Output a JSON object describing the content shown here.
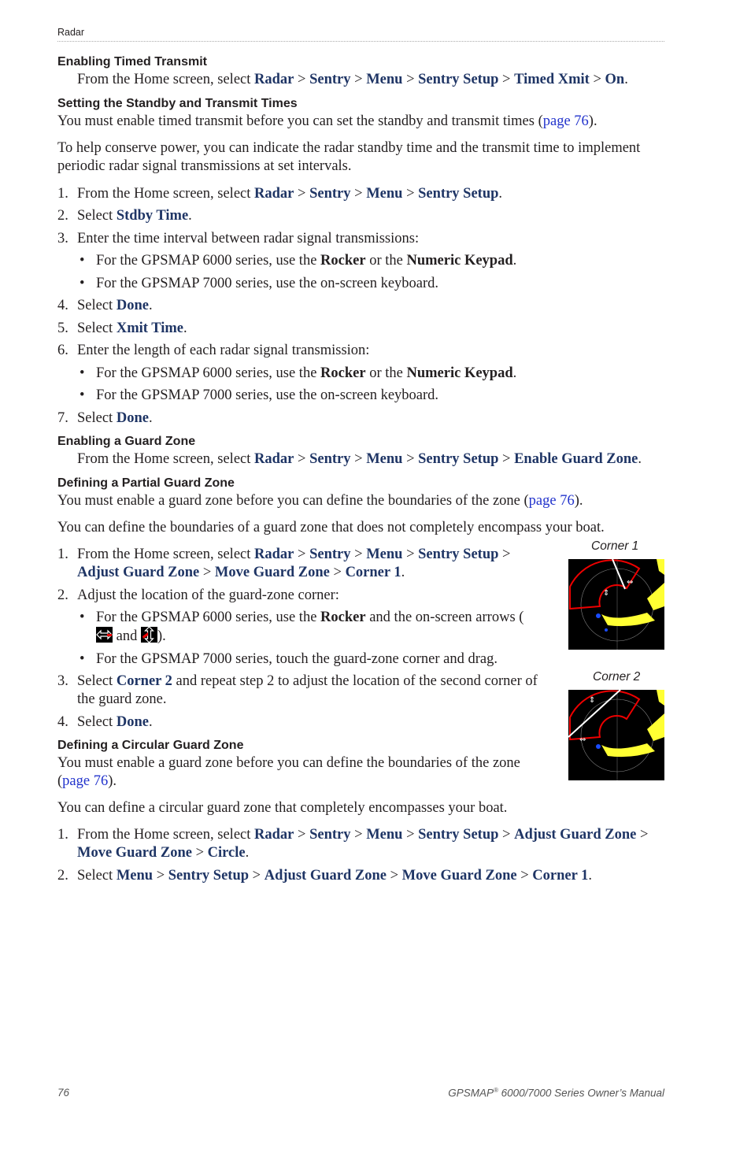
{
  "header": {
    "section": "Radar"
  },
  "sec1": {
    "title": "Enabling Timed Transmit",
    "lead": "From the Home screen, select ",
    "path": [
      "Radar",
      "Sentry",
      "Menu",
      "Sentry Setup",
      "Timed Xmit",
      "On"
    ]
  },
  "sec2": {
    "title": "Setting the Standby and Transmit Times",
    "p1_pre": "You must enable timed transmit before you can set the standby and transmit times (",
    "p1_link": "page 76",
    "p1_post": ").",
    "p2": "To help conserve power, you can indicate the radar standby time and the transmit time to implement periodic radar signal transmissions at set intervals.",
    "step1_lead": "From the Home screen, select ",
    "step1_path": [
      "Radar",
      "Sentry",
      "Menu",
      "Sentry Setup"
    ],
    "step2_lead": "Select ",
    "step2_item": "Stdby Time",
    "step3": "Enter the time interval between radar signal transmissions:",
    "bullet_6000_pre": "For the GPSMAP 6000 series, use the ",
    "rocker": "Rocker",
    "or_the": " or the ",
    "keypad": "Numeric Keypad",
    "bullet_7000": "For the GPSMAP 7000 series, use the on-screen keyboard.",
    "step4_item": "Done",
    "step5_item": "Xmit Time",
    "step6": "Enter the length of each radar signal transmission:",
    "step7_item": "Done"
  },
  "sec3": {
    "title": "Enabling a Guard Zone",
    "lead": "From the Home screen, select ",
    "path": [
      "Radar",
      "Sentry",
      "Menu",
      "Sentry Setup",
      "Enable Guard Zone"
    ]
  },
  "sec4": {
    "title": "Defining a Partial Guard Zone",
    "p1_pre": "You must enable a guard zone before you can define the boundaries of the zone (",
    "p1_link": "page 76",
    "p1_post": ").",
    "p2": "You can define the boundaries of a guard zone that does not completely encompass your boat.",
    "step1_lead": "From the Home screen, select ",
    "step1_path": [
      "Radar",
      "Sentry",
      "Menu",
      "Sentry Setup",
      "Adjust Guard Zone",
      "Move Guard Zone",
      "Corner 1"
    ],
    "step2": "Adjust the location of the guard-zone corner:",
    "bullet1_pre": "For the GPSMAP 6000 series, use the ",
    "bullet1_mid": " and the on-screen arrows (",
    "bullet1_and": " and ",
    "bullet1_post": ").",
    "bullet2": "For the GPSMAP 7000 series, touch the guard-zone corner and drag.",
    "step3_item": "Corner 2",
    "step3_post": " and repeat step 2 to adjust the location of the second corner of the guard zone.",
    "step4_item": "Done",
    "fig1_caption": "Corner 1",
    "fig2_caption": "Corner 2"
  },
  "sec5": {
    "title": "Defining a Circular Guard Zone",
    "p1_pre": "You must enable a guard zone before you can define the boundaries of the zone (",
    "p1_link": "page 76",
    "p1_post": ").",
    "p2": "You can define a circular guard zone that completely encompasses your boat.",
    "step1_lead": "From the Home screen, select ",
    "step1_path": [
      "Radar",
      "Sentry",
      "Menu",
      "Sentry Setup",
      "Adjust Guard Zone",
      "Move Guard Zone",
      "Circle"
    ],
    "step2_lead": "Select ",
    "step2_path": [
      "Menu",
      "Sentry Setup",
      "Adjust Guard Zone",
      "Move Guard Zone",
      "Corner 1"
    ]
  },
  "common": {
    "select": "Select ",
    "sep": " > ",
    "period": ".",
    "bullet": "•"
  },
  "footer": {
    "page": "76",
    "manual_pre": "GPSMAP",
    "reg": "®",
    "manual_post": " 6000/7000 Series Owner’s Manual"
  }
}
